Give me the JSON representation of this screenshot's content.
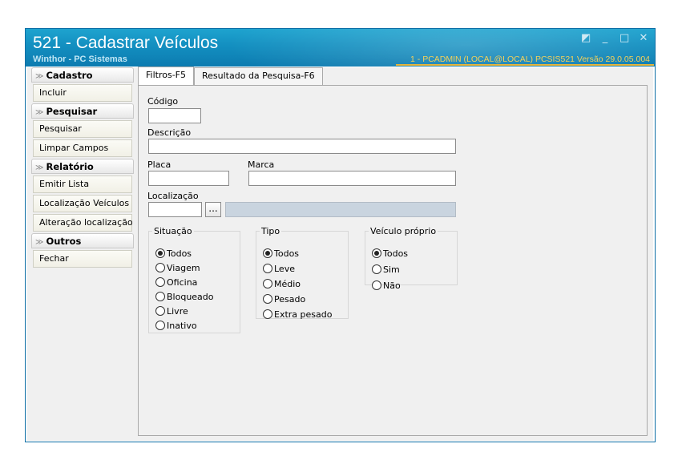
{
  "window": {
    "title": "521 - Cadastrar Veículos",
    "subtitle": "Winthor - PC Sistemas",
    "status": "1 - PCADMIN (LOCAL@LOCAL)   PCSIS521  Versão  29.0.05.004"
  },
  "sidebar": {
    "groups": [
      {
        "header": "Cadastro",
        "items": [
          "Incluir"
        ]
      },
      {
        "header": "Pesquisar",
        "items": [
          "Pesquisar",
          "Limpar Campos"
        ]
      },
      {
        "header": "Relatório",
        "items": [
          "Emitir Lista",
          "Localização Veículos",
          "Alteração localização"
        ]
      },
      {
        "header": "Outros",
        "items": [
          "Fechar"
        ]
      }
    ]
  },
  "tabs": [
    "Filtros-F5",
    "Resultado da Pesquisa-F6"
  ],
  "form": {
    "codigo_label": "Código",
    "descricao_label": "Descrição",
    "placa_label": "Placa",
    "marca_label": "Marca",
    "localizacao_label": "Localização",
    "dots_label": "..."
  },
  "situacao": {
    "legend": "Situação",
    "options": [
      "Todos",
      "Viagem",
      "Oficina",
      "Bloqueado",
      "Livre",
      "Inativo"
    ],
    "selected": "Todos"
  },
  "tipo": {
    "legend": "Tipo",
    "options": [
      "Todos",
      "Leve",
      "Médio",
      "Pesado",
      "Extra pesado"
    ],
    "selected": "Todos"
  },
  "proprio": {
    "legend": "Veículo próprio",
    "options": [
      "Todos",
      "Sim",
      "Não"
    ],
    "selected": "Todos"
  },
  "colors": {
    "titlebar": "#138fc0",
    "accent": "#e8b53a"
  }
}
